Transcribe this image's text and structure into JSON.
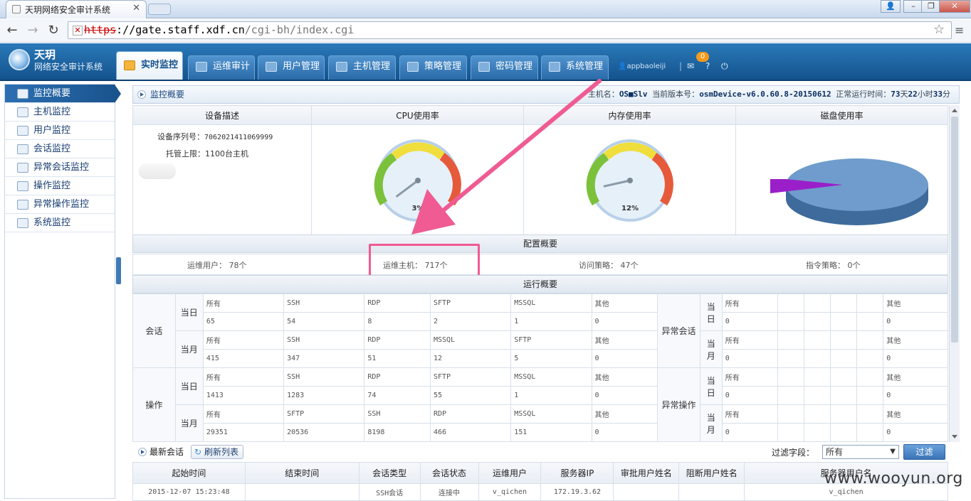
{
  "browser": {
    "tab_title": "天玥网络安全审计系统",
    "url_scheme": "https",
    "url_host": "://gate.staff.xdf.cn",
    "url_path": "/cgi-bh/index.cgi"
  },
  "app": {
    "brand_name": "天玥",
    "brand_sub": "网络安全审计系统",
    "nav": [
      "实时监控",
      "运维审计",
      "用户管理",
      "主机管理",
      "策略管理",
      "密码管理",
      "系统管理"
    ],
    "user": "appbaoleiji",
    "msg_count": "0"
  },
  "sidebar": {
    "items": [
      "监控概要",
      "主机监控",
      "用户监控",
      "会话监控",
      "异常会话监控",
      "操作监控",
      "异常操作监控",
      "系统监控"
    ]
  },
  "panel": {
    "title": "监控概要",
    "sys_host_label": "主机名：",
    "sys_host": "OS■Slv",
    "sys_ver_label": "当前版本号：",
    "sys_ver": "osmDevice-v6.0.60.8-20150612",
    "uptime_label": "正常运行时间：",
    "uptime_d": "73",
    "uptime_d_unit": "天",
    "uptime_h": "22",
    "uptime_h_unit": "小时",
    "uptime_m": "33",
    "uptime_m_unit": "分"
  },
  "device": {
    "headers": [
      "设备描述",
      "CPU使用率",
      "内存使用率",
      "磁盘使用率"
    ],
    "serial_label": "设备序列号：",
    "serial": "7062021411069999",
    "limit_label": "托管上限：",
    "limit": "1100台主机",
    "cpu_pct": 3,
    "cpu_label": "3%",
    "mem_pct": 12,
    "mem_label": "12%"
  },
  "config": {
    "title": "配置概要",
    "ops_users": "运维用户： 78个",
    "ops_hosts": "运维主机： 717个",
    "access_policy": "访问策略： 47个",
    "cmd_policy": "指令策略： 0个"
  },
  "run": {
    "title": "运行概要",
    "session": "会话",
    "operation": "操作",
    "abn_session": "异常会话",
    "abn_operation": "异常操作",
    "day": "当日",
    "month": "当月",
    "blocks": [
      {
        "h": [
          "所有",
          "SSH",
          "RDP",
          "SFTP",
          "MSSQL",
          "其他"
        ],
        "v": [
          "65",
          "54",
          "8",
          "2",
          "1",
          "0"
        ]
      },
      {
        "h": [
          "所有",
          "SSH",
          "RDP",
          "MSSQL",
          "SFTP",
          "其他"
        ],
        "v": [
          "415",
          "347",
          "51",
          "12",
          "5",
          "0"
        ]
      },
      {
        "h": [
          "所有",
          "SSH",
          "RDP",
          "SFTP",
          "MSSQL",
          "其他"
        ],
        "v": [
          "1413",
          "1283",
          "74",
          "55",
          "1",
          "0"
        ]
      },
      {
        "h": [
          "所有",
          "SFTP",
          "SSH",
          "RDP",
          "MSSQL",
          "其他"
        ],
        "v": [
          "29351",
          "20536",
          "8198",
          "466",
          "151",
          "0"
        ]
      }
    ],
    "abn": {
      "h_all": "所有",
      "h_other": "其他",
      "v": "0"
    }
  },
  "sessions": {
    "title": "最新会话",
    "refresh": "刷新列表",
    "filter_label": "过滤字段：",
    "filter_value": "所有",
    "filter_btn": "过滤",
    "columns": [
      "起始时间",
      "结束时间",
      "会话类型",
      "会话状态",
      "运维用户",
      "服务器IP",
      "审批用户姓名",
      "阻断用户姓名",
      "服务器用户名"
    ],
    "rows": [
      [
        "2015-12-07 15:23:48",
        "",
        "SSH会话",
        "连接中",
        "v_qichen",
        "172.19.3.62",
        "",
        "",
        "v_qichen"
      ]
    ]
  },
  "watermark": "www.wooyun.org",
  "colors": {
    "accent": "#1a548e",
    "highlight": "#ef5b92"
  }
}
